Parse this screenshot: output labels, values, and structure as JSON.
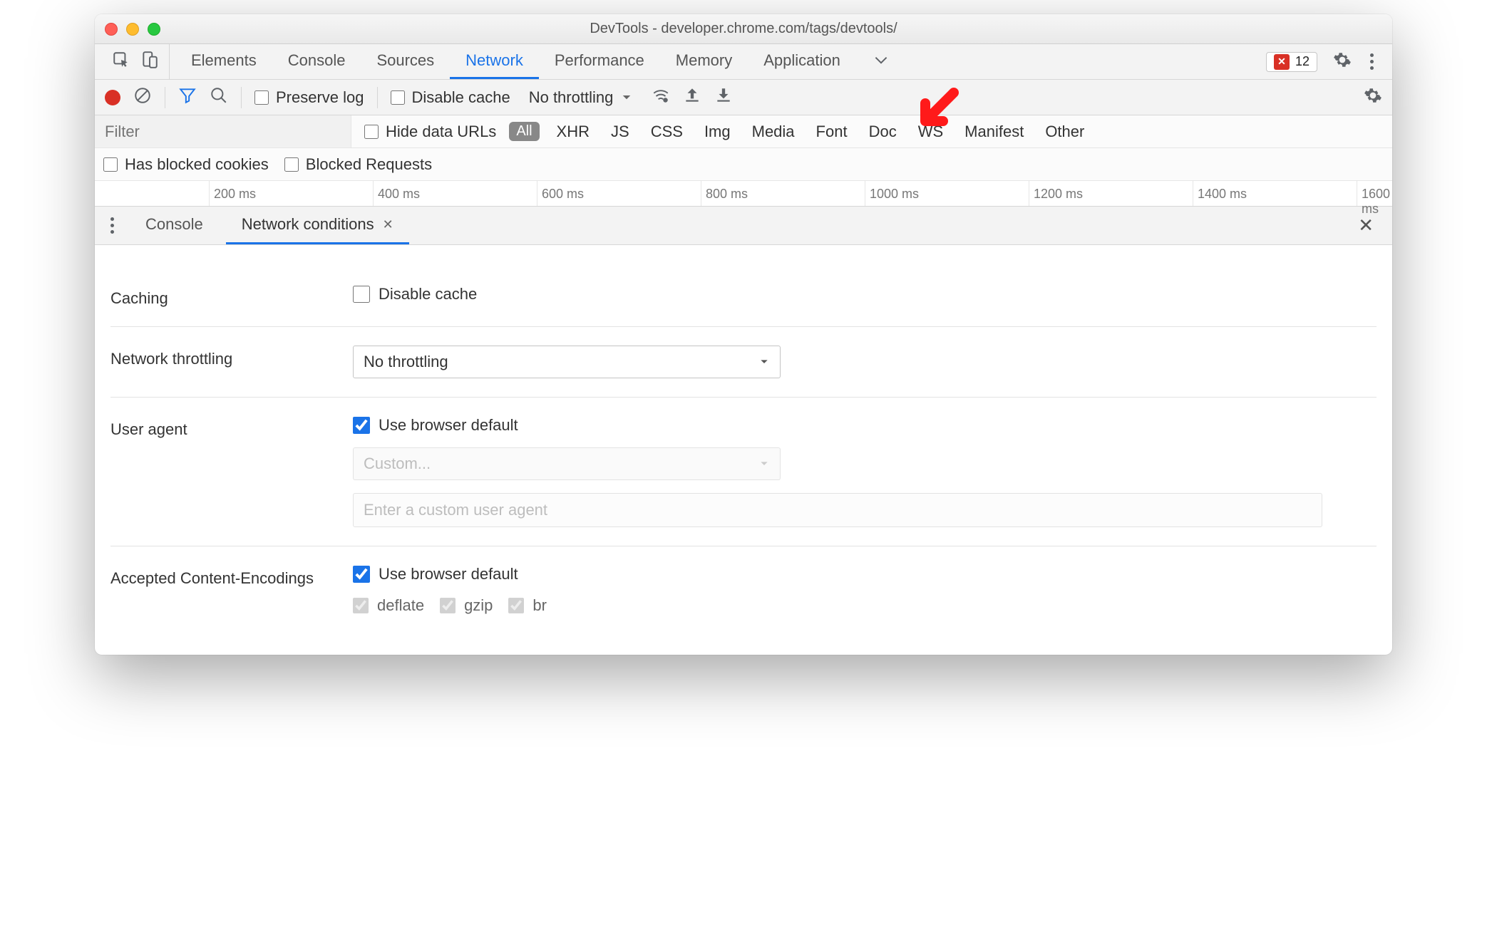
{
  "window": {
    "title": "DevTools - developer.chrome.com/tags/devtools/"
  },
  "tabs": {
    "items": [
      "Elements",
      "Console",
      "Sources",
      "Network",
      "Performance",
      "Memory",
      "Application"
    ],
    "active": "Network",
    "error_count": "12"
  },
  "net_toolbar": {
    "preserve_log": "Preserve log",
    "disable_cache": "Disable cache",
    "throttling": "No throttling"
  },
  "filter": {
    "placeholder": "Filter",
    "hide_data_urls": "Hide data URLs",
    "all": "All",
    "types": [
      "XHR",
      "JS",
      "CSS",
      "Img",
      "Media",
      "Font",
      "Doc",
      "WS",
      "Manifest",
      "Other"
    ]
  },
  "filter2": {
    "blocked_cookies": "Has blocked cookies",
    "blocked_requests": "Blocked Requests"
  },
  "timeline": {
    "ticks": [
      "200 ms",
      "400 ms",
      "600 ms",
      "800 ms",
      "1000 ms",
      "1200 ms",
      "1400 ms",
      "1600 ms"
    ]
  },
  "drawer_tabs": {
    "console": "Console",
    "netcond": "Network conditions"
  },
  "netcond": {
    "caching_label": "Caching",
    "caching_disable": "Disable cache",
    "throttling_label": "Network throttling",
    "throttling_value": "No throttling",
    "ua_label": "User agent",
    "ua_usebrowser": "Use browser default",
    "ua_custom": "Custom...",
    "ua_placeholder": "Enter a custom user agent",
    "enc_label": "Accepted Content-Encodings",
    "enc_usebrowser": "Use browser default",
    "enc_deflate": "deflate",
    "enc_gzip": "gzip",
    "enc_br": "br"
  }
}
